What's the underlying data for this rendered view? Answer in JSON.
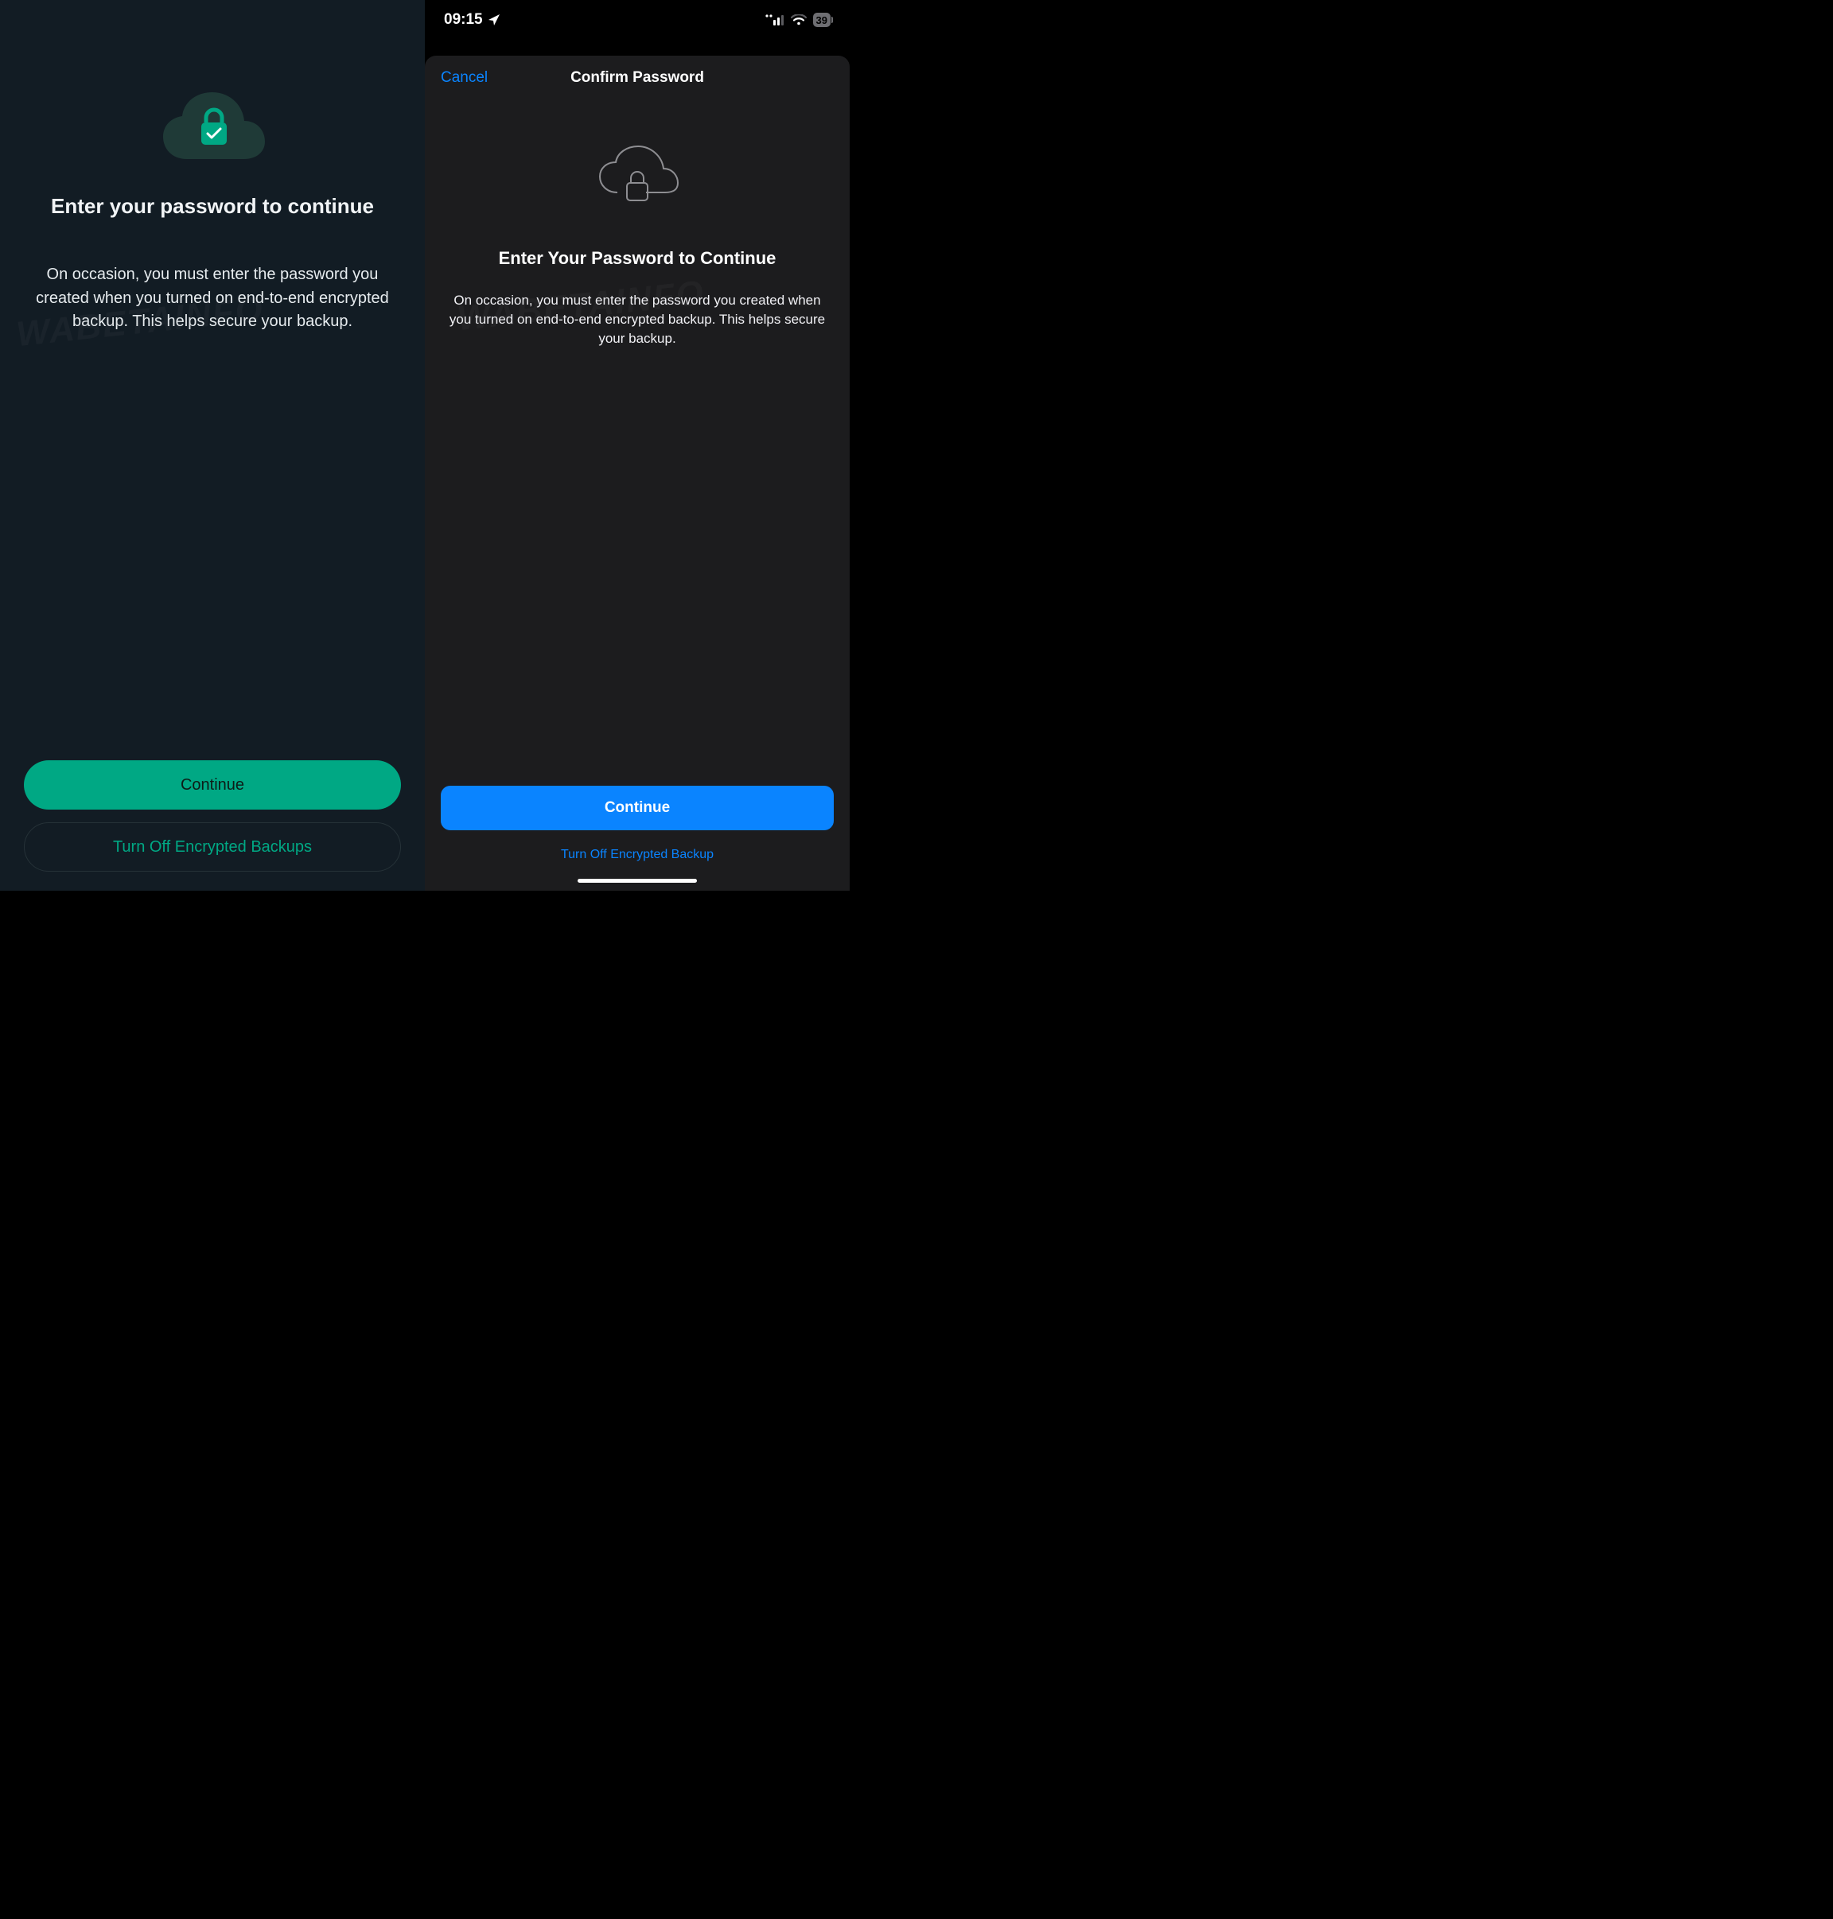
{
  "left": {
    "heading": "Enter your password to continue",
    "description": "On occasion, you must enter the password you created when you turned on end-to-end encrypted backup. This helps secure your backup.",
    "continue_label": "Continue",
    "turn_off_label": "Turn Off Encrypted Backups"
  },
  "right": {
    "status_time": "09:15",
    "battery_level": "39",
    "cancel_label": "Cancel",
    "sheet_title": "Confirm Password",
    "heading": "Enter Your Password to Continue",
    "description": "On occasion, you must enter the password you created when you turned on end-to-end encrypted backup. This helps secure your backup.",
    "continue_label": "Continue",
    "turn_off_label": "Turn Off Encrypted Backup"
  },
  "watermark": "WABETAINFO"
}
